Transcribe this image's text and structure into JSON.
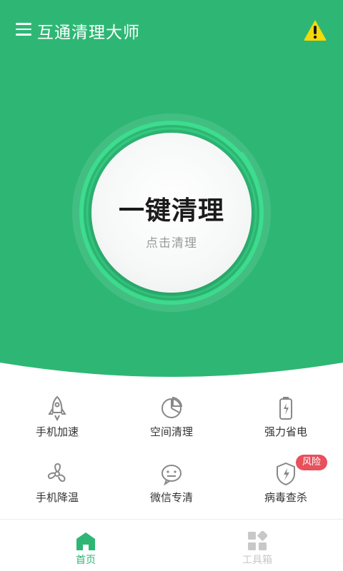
{
  "header": {
    "menu_icon": "hamburger-menu-icon",
    "title": "互通清理大师",
    "warning_icon": "warning-triangle-icon"
  },
  "colors": {
    "brand": "#2eb774",
    "ring": "#3ddc8e",
    "warning": "#f5d90a",
    "risk": "#e8505b",
    "active_tab": "#2eb774",
    "inactive_tab": "#c8c8c8"
  },
  "dial": {
    "title": "一键清理",
    "subtitle": "点击清理"
  },
  "tools": [
    {
      "label": "手机加速",
      "icon": "rocket-icon"
    },
    {
      "label": "空间清理",
      "icon": "pie-chart-icon"
    },
    {
      "label": "强力省电",
      "icon": "battery-icon"
    },
    {
      "label": "手机降温",
      "icon": "fan-icon"
    },
    {
      "label": "微信专清",
      "icon": "wechat-icon"
    },
    {
      "label": "病毒查杀",
      "icon": "shield-icon",
      "badge": "风险"
    }
  ],
  "tabs": [
    {
      "label": "首页",
      "icon": "home-icon",
      "active": true
    },
    {
      "label": "工具箱",
      "icon": "toolbox-grid-icon",
      "active": false
    }
  ]
}
